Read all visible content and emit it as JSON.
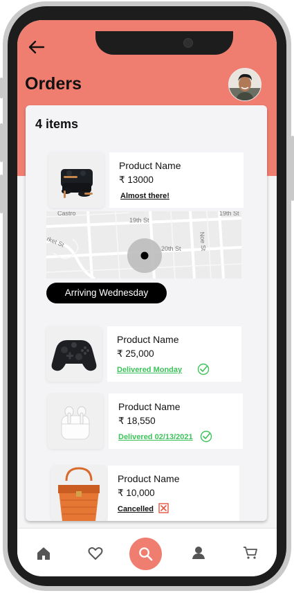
{
  "header": {
    "title": "Orders",
    "back_icon": "arrow-left-icon",
    "accent_color": "#f07e70"
  },
  "orders_card": {
    "items_count": "4 items",
    "orders": [
      {
        "product_name": "Product Name",
        "price": "₹ 13000",
        "status": "Almost there!",
        "status_kind": "in-transit"
      },
      {
        "product_name": "Product Name",
        "price": "₹ 25,000",
        "status": "Delivered Monday",
        "status_kind": "delivered"
      },
      {
        "product_name": "Product Name",
        "price": "₹ 18,550",
        "status": "Delivered 02/13/2021",
        "status_kind": "delivered"
      },
      {
        "product_name": "Product Name",
        "price": "₹ 10,000",
        "status": "Cancelled",
        "status_kind": "cancelled"
      }
    ],
    "map": {
      "streets": [
        "19th St",
        "20th St",
        "Noe St",
        "19th St",
        "Castro",
        "rket St"
      ]
    },
    "arriving_label": "Arriving Wednesday"
  },
  "bottom_nav": {
    "items": [
      {
        "icon": "home-icon"
      },
      {
        "icon": "heart-icon"
      },
      {
        "icon": "search-icon"
      },
      {
        "icon": "user-icon"
      },
      {
        "icon": "cart-icon"
      }
    ]
  }
}
